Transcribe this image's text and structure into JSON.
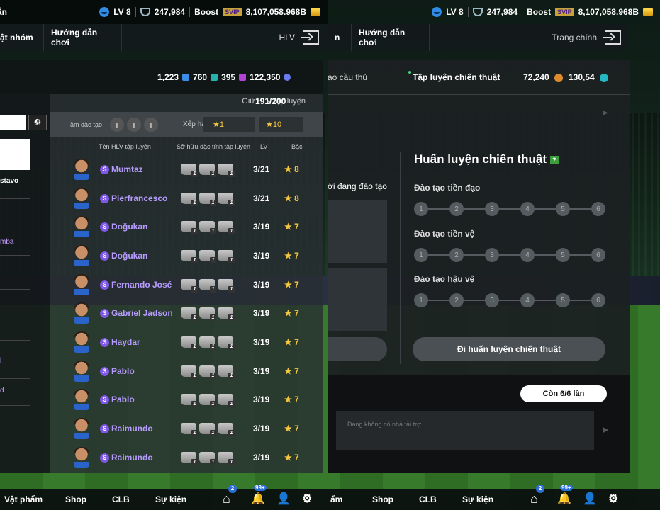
{
  "topbar": {
    "level": "LV 8",
    "trophies": "247,984",
    "boost": "Boost",
    "svip": "SVIP",
    "gold": "8,107,058.968B"
  },
  "left": {
    "nav": {
      "guide_cut": "ẫn",
      "group_cut": "ật nhóm",
      "guide": "Hướng dẫn chơi",
      "hlv": "HLV"
    },
    "currencies": [
      "1,223",
      "760",
      "395",
      "122,350"
    ],
    "coach_label": "Giữ HLV tập luyện",
    "coach_count": "191/200",
    "filter": {
      "train_label": "ầm đào tạo",
      "sort_label": "Xếp hạ",
      "star_from": "★1",
      "star_to": "★10"
    },
    "columns": {
      "name": "Tên HLV tập luyện",
      "traits": "Sở hữu đặc tính tập luyện",
      "lv": "LV",
      "grade": "Bậc"
    },
    "side_labels": [
      "stavo",
      "mba",
      "l",
      "d"
    ],
    "coaches": [
      {
        "name": "Mumtaz",
        "lv": "3/21",
        "grade": "★ 8"
      },
      {
        "name": "Pierfrancesco",
        "lv": "3/21",
        "grade": "★ 8"
      },
      {
        "name": "Doğukan",
        "lv": "3/19",
        "grade": "★ 7"
      },
      {
        "name": "Doğukan",
        "lv": "3/19",
        "grade": "★ 7"
      },
      {
        "name": "Fernando José",
        "lv": "3/19",
        "grade": "★ 7"
      },
      {
        "name": "Gabriel Jadson",
        "lv": "3/19",
        "grade": "★ 7"
      },
      {
        "name": "Haydar",
        "lv": "3/19",
        "grade": "★ 7"
      },
      {
        "name": "Pablo",
        "lv": "3/19",
        "grade": "★ 7"
      },
      {
        "name": "Pablo",
        "lv": "3/19",
        "grade": "★ 7"
      },
      {
        "name": "Raimundo",
        "lv": "3/19",
        "grade": "★ 7"
      },
      {
        "name": "Raimundo",
        "lv": "3/19",
        "grade": "★ 7"
      }
    ],
    "bottom": {
      "items_cut": "Vật phẩm",
      "shop": "Shop",
      "clb": "CLB",
      "event": "Sự kiện",
      "badge1": "2",
      "badge2": "99+"
    }
  },
  "right": {
    "nav": {
      "n_cut": "n",
      "guide": "Hướng dẫn chơi",
      "home": "Trang chính"
    },
    "tabs": {
      "player_cut": "ạo cầu thủ",
      "tactic": "Tập luyện chiến thuật",
      "coins1": "72,240",
      "coins2": "130,54"
    },
    "training_cut": "ời đang đào tạo",
    "title": "Huấn luyện chiến thuật",
    "rows": [
      {
        "label": "Đào tạo tiền đạo",
        "dots": [
          "1",
          "2",
          "3",
          "4",
          "5",
          "6"
        ]
      },
      {
        "label": "Đào tạo tiền vệ",
        "dots": [
          "1",
          "2",
          "3",
          "4",
          "5",
          "6"
        ]
      },
      {
        "label": "Đào tạo hậu vệ",
        "dots": [
          "1",
          "2",
          "3",
          "4",
          "5",
          "6"
        ]
      }
    ],
    "go_button": "Đi huấn luyện chiến thuật",
    "remaining": "Còn 6/6 lần",
    "sponsor": "Đang không có nhà tài trợ",
    "sponsor_dash": "-",
    "bottom": {
      "items_cut": "ẩm",
      "shop": "Shop",
      "clb": "CLB",
      "event": "Sự kiện",
      "badge1": "2",
      "badge2": "99+"
    }
  },
  "colors": {
    "accent": "#7e58e6",
    "gold": "#f5c841"
  }
}
